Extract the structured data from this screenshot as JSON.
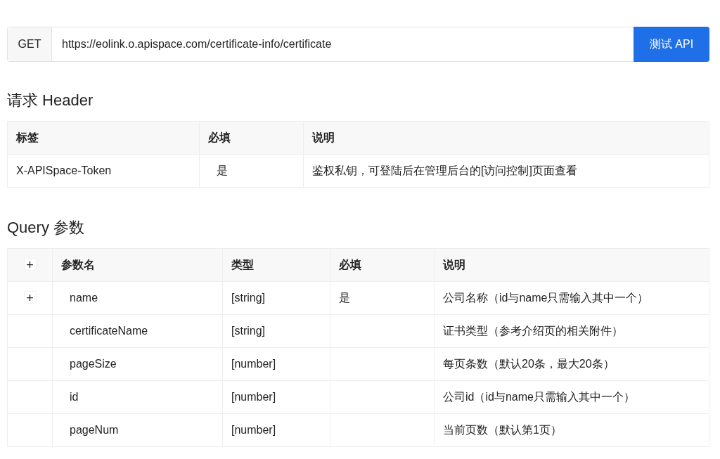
{
  "request_bar": {
    "method": "GET",
    "url": "https://eolink.o.apispace.com/certificate-info/certificate",
    "test_button": "测试 API"
  },
  "header_section": {
    "title": "请求 Header",
    "columns": [
      "标签",
      "必填",
      "说明"
    ],
    "rows": [
      {
        "cells": [
          "X-APISpace-Token",
          "是",
          "鉴权私钥，可登陆后在管理后台的[访问控制]页面查看"
        ]
      }
    ]
  },
  "query_section": {
    "title": "Query 参数",
    "expand_all": "+",
    "columns": [
      "参数名",
      "类型",
      "必填",
      "说明"
    ],
    "rows": [
      {
        "expand": "+",
        "cells": [
          "name",
          "[string]",
          "是",
          "公司名称（id与name只需输入其中一个）"
        ]
      },
      {
        "cells": [
          "certificateName",
          "[string]",
          "",
          "证书类型（参考介绍页的相关附件）"
        ]
      },
      {
        "cells": [
          "pageSize",
          "[number]",
          "",
          "每页条数（默认20条，最大20条）"
        ]
      },
      {
        "cells": [
          "id",
          "[number]",
          "",
          "公司id（id与name只需输入其中一个）"
        ]
      },
      {
        "cells": [
          "pageNum",
          "[number]",
          "",
          "当前页数（默认第1页）"
        ]
      }
    ]
  }
}
